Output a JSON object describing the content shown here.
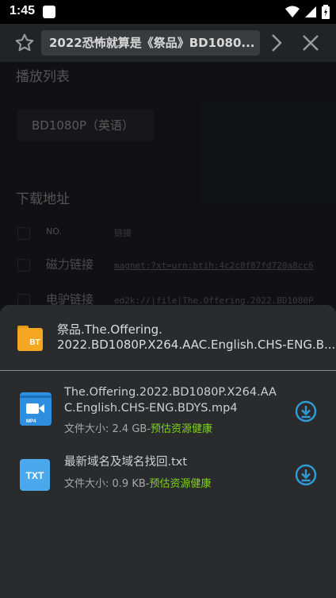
{
  "status_bar": {
    "time": "1:45"
  },
  "top_bar": {
    "title": "2022恐怖就算是《祭品》BD1080..."
  },
  "background": {
    "playlist_title": "播放列表",
    "playlist_item": "BD1080P（英语）",
    "download_title": "下载地址",
    "table_header": {
      "no": "NO.",
      "link": "链接"
    },
    "rows": [
      {
        "name": "磁力链接",
        "link": "magnet:?xt=urn:btih:4c2c8f87fd720a8cc6"
      },
      {
        "name": "电驴链接",
        "link": "ed2k://|file|The.Offering.2022.BD1080P"
      }
    ]
  },
  "sheet": {
    "torrent_name": "祭品.The.Offering.2022.BD1080P.X264.AAC.English.CHS-ENG.B...",
    "torrent_name_line1": "祭品.The.Offering.",
    "torrent_name_line2": "2022.BD1080P.X264.AAC.English.CHS-ENG.B...",
    "files": [
      {
        "name": "The.Offering.2022.BD1080P.X264.AAC.English.CHS-ENG.BDYS.mp4",
        "size": "文件大小: 2.4 GB",
        "sep": "-",
        "health": "预估资源健康",
        "icon": "mp4-file-icon",
        "icon_label": "MP4"
      },
      {
        "name": "最新域名及域名找回.txt",
        "size": "文件大小: 0.9 KB",
        "sep": "-",
        "health": "预估资源健康",
        "icon": "txt-file-icon",
        "icon_label": "TXT"
      }
    ]
  },
  "colors": {
    "accent_blue": "#2e9bd6",
    "health_green": "#7ed321",
    "folder_orange": "#f5a623"
  }
}
